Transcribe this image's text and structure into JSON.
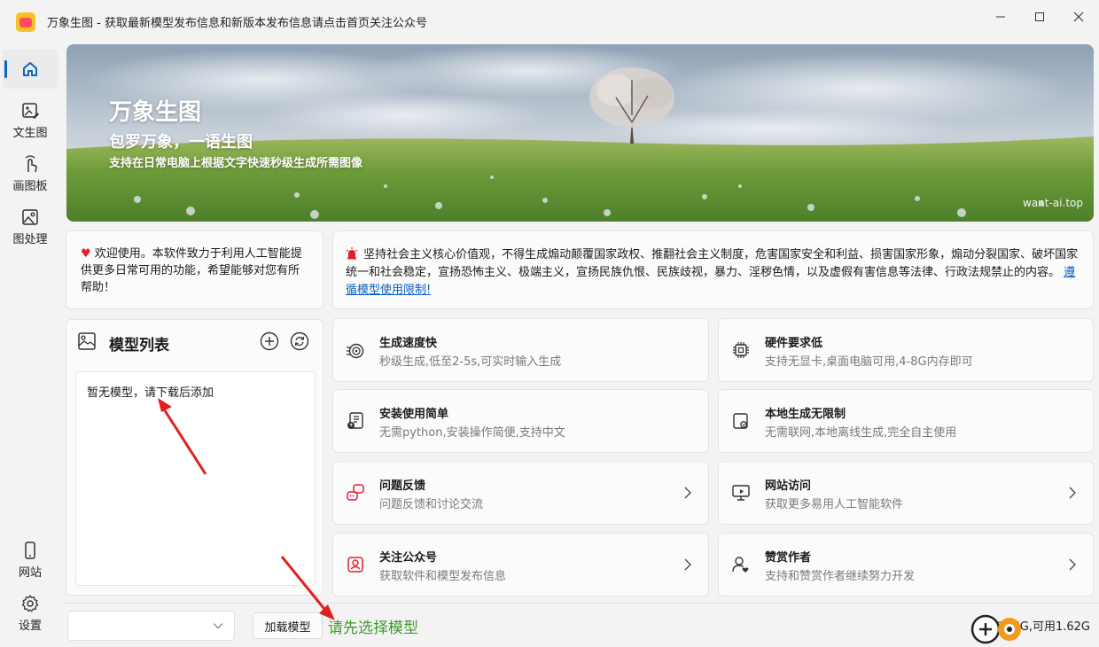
{
  "titlebar": {
    "title": "万象生图 - 获取最新模型发布信息和新版本发布信息请点击首页关注公众号"
  },
  "sidebar": {
    "items": [
      {
        "label": ""
      },
      {
        "label": "文生图"
      },
      {
        "label": "画图板"
      },
      {
        "label": "图处理"
      },
      {
        "label": "网站"
      },
      {
        "label": "设置"
      }
    ]
  },
  "banner": {
    "title": "万象生图",
    "subtitle": "包罗万象，一语生图",
    "description": "支持在日常电脑上根据文字快速秒级生成所需图像",
    "url": "want-ai.top"
  },
  "welcome": {
    "text": "欢迎使用。本软件致力于利用人工智能提供更多日常可用的功能，希望能够对您有所帮助！"
  },
  "notice": {
    "text": "坚持社会主义核心价值观，不得生成煽动颠覆国家政权、推翻社会主义制度，危害国家安全和利益、损害国家形象，煽动分裂国家、破坏国家统一和社会稳定，宣扬恐怖主义、极端主义，宣扬民族仇恨、民族歧视，暴力、淫秽色情，以及虚假有害信息等法律、行政法规禁止的内容。",
    "link": "遵循模型使用限制!"
  },
  "model_panel": {
    "title": "模型列表",
    "empty_text": "暂无模型，请下载后添加"
  },
  "features": [
    {
      "title": "生成速度快",
      "desc": "秒级生成,低至2-5s,可实时输入生成",
      "icon": "speed-icon"
    },
    {
      "title": "硬件要求低",
      "desc": "支持无显卡,桌面电脑可用,4-8G内存即可",
      "icon": "chip-icon"
    },
    {
      "title": "安装使用简单",
      "desc": "无需python,安装操作简便,支持中文",
      "icon": "install-icon"
    },
    {
      "title": "本地生成无限制",
      "desc": "无需联网,本地离线生成,完全自主使用",
      "icon": "local-icon"
    },
    {
      "title": "问题反馈",
      "desc": "问题反馈和讨论交流",
      "icon": "feedback-icon"
    },
    {
      "title": "网站访问",
      "desc": "获取更多易用人工智能软件",
      "icon": "monitor-icon"
    },
    {
      "title": "关注公众号",
      "desc": "获取软件和模型发布信息",
      "icon": "wechat-icon"
    },
    {
      "title": "赞赏作者",
      "desc": "支持和赞赏作者继续努力开发",
      "icon": "user-icon"
    }
  ],
  "bottom": {
    "select_value": "",
    "load_button": "加载模型",
    "status": "请先选择模型",
    "memory": "内存:16G,可用1.62G"
  },
  "colors": {
    "accent": "#0a66c2",
    "status_green": "#3f9b2d",
    "alert_red": "#e0202f",
    "annotation_arrow": "#e02020"
  }
}
